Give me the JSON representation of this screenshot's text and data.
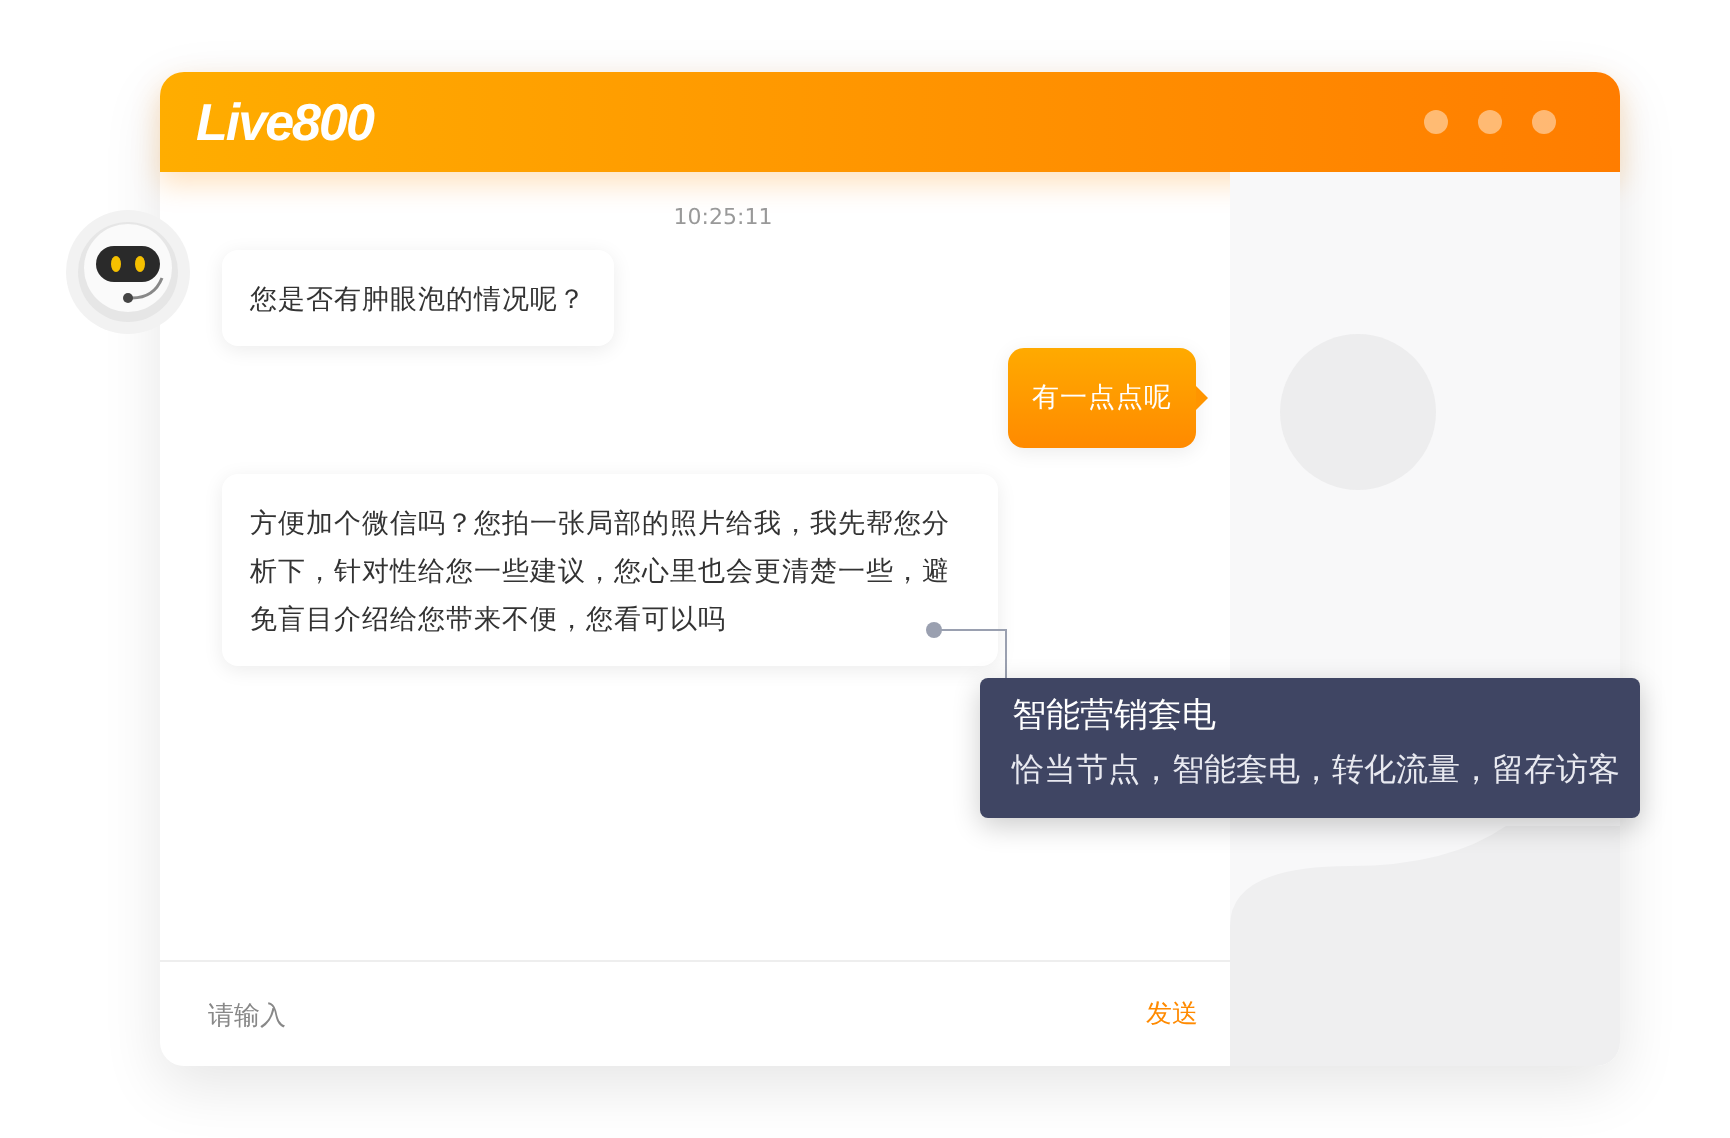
{
  "header": {
    "logo": "Live800"
  },
  "chat": {
    "timestamp": "10:25:11",
    "messages": [
      {
        "kind": "bot",
        "avatar": true,
        "text": "您是否有肿眼泡的情况呢？"
      },
      {
        "kind": "user",
        "avatar": false,
        "text": "有一点点呢"
      },
      {
        "kind": "bot",
        "avatar": false,
        "text": "方便加个微信吗？您拍一张局部的照片给我，我先帮您分析下，针对性给您一些建议，您心里也会更清楚一些，避免盲目介绍给您带来不便，您看可以吗"
      }
    ]
  },
  "input": {
    "placeholder": "请输入",
    "send": "发送"
  },
  "tooltip": {
    "title": "智能营销套电",
    "text": "恰当节点，智能套电，转化流量，留存访客"
  }
}
